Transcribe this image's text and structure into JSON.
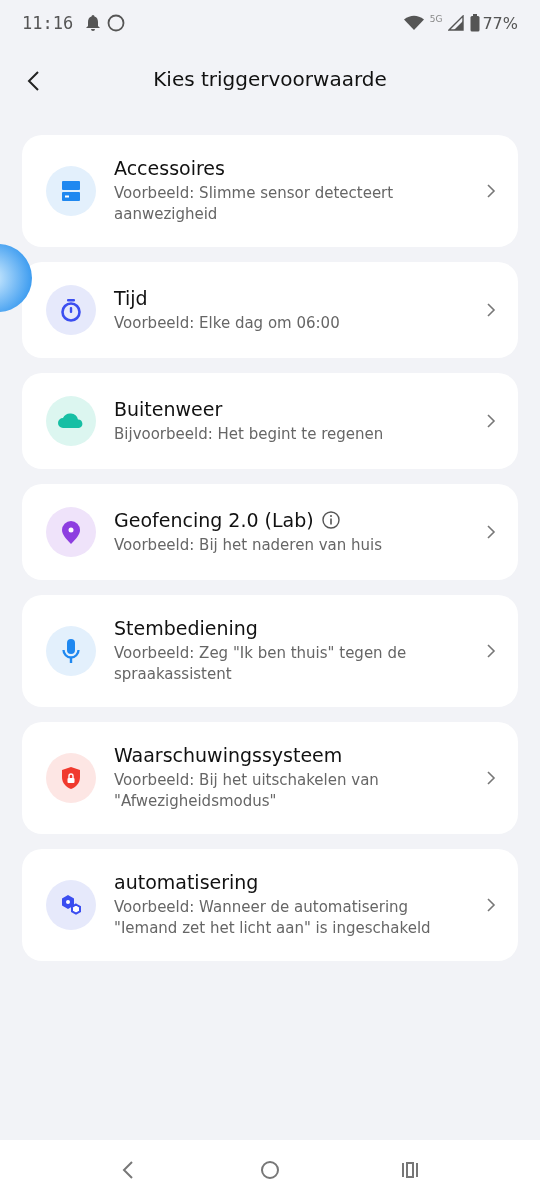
{
  "status_bar": {
    "time": "11:16",
    "network": "5G",
    "battery": "77%"
  },
  "header": {
    "title": "Kies triggervoorwaarde"
  },
  "items": [
    {
      "kind": "accessory",
      "title": "Accessoires",
      "subtitle": "Voorbeeld: Slimme sensor detecteert aanwezigheid",
      "info": false
    },
    {
      "kind": "timer",
      "title": "Tijd",
      "subtitle": "Voorbeeld: Elke dag om 06:00",
      "info": false
    },
    {
      "kind": "weather",
      "title": "Buitenweer",
      "subtitle": "Bijvoorbeeld: Het begint te regenen",
      "info": false
    },
    {
      "kind": "location",
      "title": "Geofencing 2.0 (Lab)",
      "subtitle": "Voorbeeld: Bij het naderen van huis",
      "info": true
    },
    {
      "kind": "voice",
      "title": "Stembediening",
      "subtitle": "Voorbeeld: Zeg \"Ik ben thuis\" tegen de spraakassistent",
      "info": false
    },
    {
      "kind": "security",
      "title": "Waarschuwingssysteem",
      "subtitle": "Voorbeeld: Bij het uitschakelen van \"Afwezigheidsmodus\"",
      "info": false
    },
    {
      "kind": "automation",
      "title": "automatisering",
      "subtitle": "Voorbeeld: Wanneer de automatisering \"Iemand zet het licht aan\" is ingeschakeld",
      "info": false
    }
  ]
}
